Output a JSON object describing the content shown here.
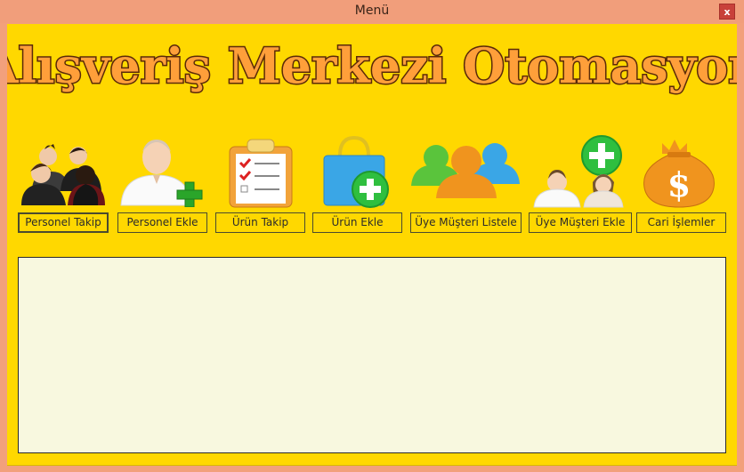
{
  "window": {
    "title": "Menü",
    "close_label": "x"
  },
  "banner": {
    "text": "Alışveriş Merkezi Otomasyon"
  },
  "menu": {
    "personel_takip": "Personel Takip",
    "personel_ekle": "Personel Ekle",
    "urun_takip": "Ürün Takip",
    "urun_ekle": "Ürün Ekle",
    "uye_musteri_listele": "Üye Müşteri Listele",
    "uye_musteri_ekle": "Üye Müşteri Ekle",
    "cari_islemler": "Cari İşlemler"
  },
  "colors": {
    "background": "#ffd800",
    "banner_fill": "#ff9f3a",
    "panel": "#f8f8df"
  }
}
